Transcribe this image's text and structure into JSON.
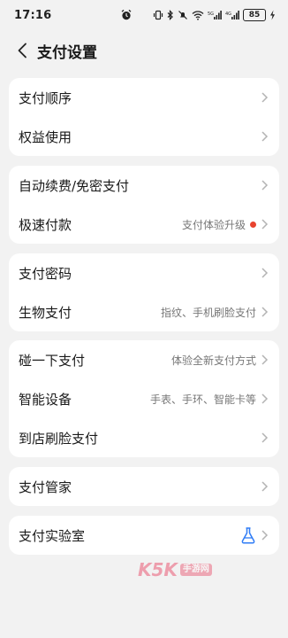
{
  "status_bar": {
    "time": "17:16",
    "battery": "85"
  },
  "header": {
    "title": "支付设置"
  },
  "groups": [
    {
      "rows": [
        {
          "label": "支付顺序"
        },
        {
          "label": "权益使用"
        }
      ]
    },
    {
      "rows": [
        {
          "label": "自动续费/免密支付"
        },
        {
          "label": "极速付款",
          "value": "支付体验升级",
          "dot_color": "#e8432f"
        }
      ]
    },
    {
      "rows": [
        {
          "label": "支付密码"
        },
        {
          "label": "生物支付",
          "value": "指纹、手机刷脸支付"
        }
      ]
    },
    {
      "rows": [
        {
          "label": "碰一下支付",
          "value": "体验全新支付方式"
        },
        {
          "label": "智能设备",
          "value": "手表、手环、智能卡等"
        },
        {
          "label": "到店刷脸支付"
        }
      ]
    },
    {
      "rows": [
        {
          "label": "支付管家"
        }
      ]
    },
    {
      "rows": [
        {
          "label": "支付实验室",
          "icon": "flask-icon"
        }
      ]
    }
  ],
  "watermark": {
    "brand": "K5K",
    "badge": "手游网"
  },
  "colors": {
    "background": "#f2f2f2",
    "card": "#ffffff",
    "accent_blue": "#2f7cf6",
    "dot_red": "#e8432f"
  }
}
